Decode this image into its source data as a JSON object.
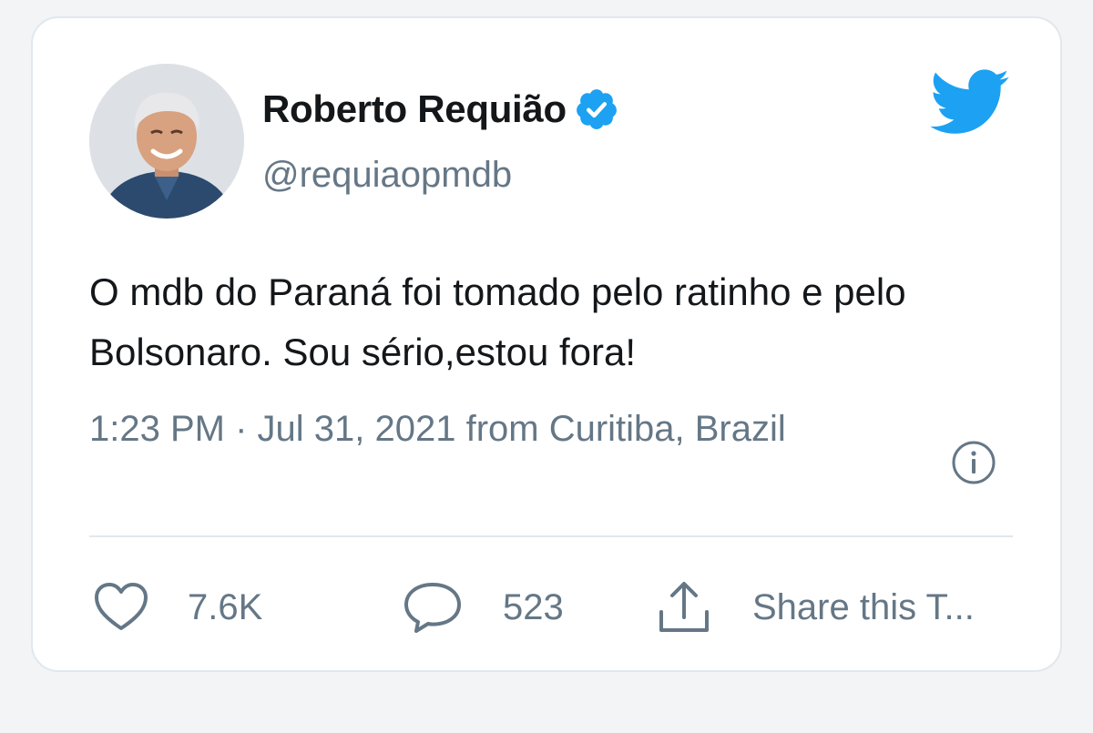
{
  "tweet": {
    "author": {
      "display_name": "Roberto Requião",
      "handle": "@requiaopmdb",
      "verified": true,
      "avatar_icon": "profile-photo"
    },
    "brand_icon": "twitter-bird-icon",
    "text": "O mdb do Paraná foi tomado pelo ratinho e pelo Bolsonaro. Sou sério,estou fora!",
    "timestamp": "1:23 PM · Jul 31, 2021 from Curitiba, Brazil",
    "info_icon": "info-icon",
    "actions": {
      "like_count": "7.6K",
      "reply_count": "523",
      "share_label": "Share this T..."
    }
  },
  "colors": {
    "brand_blue": "#1da1f2",
    "text_primary": "#14171a",
    "text_secondary": "#657786",
    "border": "#e1e8ed"
  }
}
